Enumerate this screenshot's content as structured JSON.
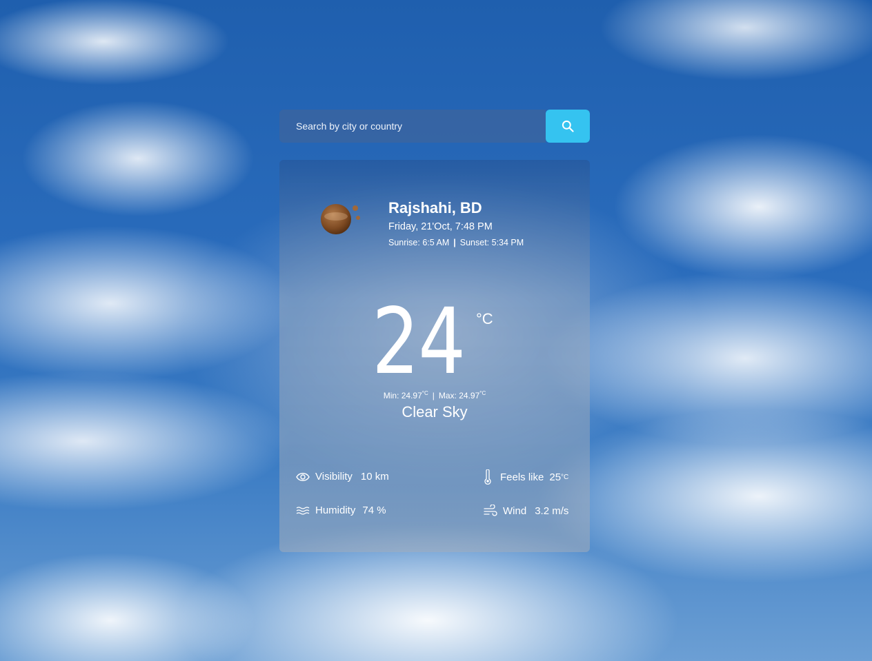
{
  "search": {
    "placeholder": "Search by city or country",
    "button_icon": "search-icon"
  },
  "weather": {
    "icon": "clear-night-moon-icon",
    "city": "Rajshahi, BD",
    "datetime": "Friday, 21'Oct, 7:48 PM",
    "sunrise": "Sunrise: 6:5 AM",
    "sunset": "Sunset: 5:34 PM",
    "temperature": "24",
    "temp_unit": "°C",
    "min": "Min: 24.97",
    "max": "Max: 24.97",
    "minmax_unit": "°C",
    "condition": "Clear Sky"
  },
  "details": {
    "visibility": {
      "icon": "eye-icon",
      "label": "Visibility",
      "value": "10 km"
    },
    "feels_like": {
      "icon": "thermometer-icon",
      "label": "Feels like",
      "value": "25",
      "unit": "°C"
    },
    "humidity": {
      "icon": "humidity-waves-icon",
      "label": "Humidity",
      "value": "74 %"
    },
    "wind": {
      "icon": "wind-icon",
      "label": "Wind",
      "value": "3.2 m/s"
    }
  },
  "colors": {
    "accent": "#35c3f0",
    "moon": "#8b5a2b"
  }
}
